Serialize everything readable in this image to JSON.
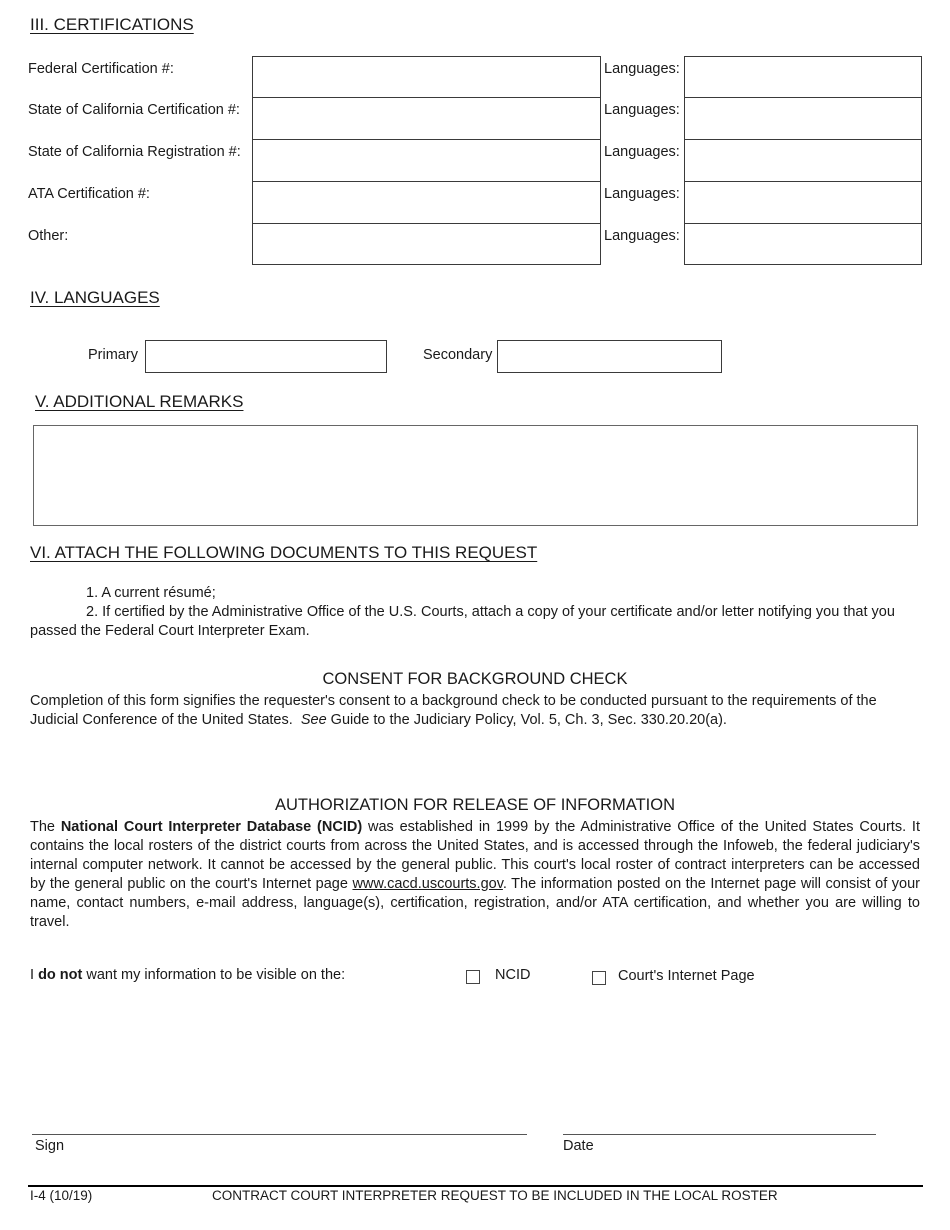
{
  "certifications": {
    "heading": "III.  CERTIFICATIONS",
    "rows": [
      {
        "label": "Federal Certification #:",
        "value": "",
        "languages_label": "Languages:",
        "languages_value": ""
      },
      {
        "label": "State of California Certification #:",
        "value": "",
        "languages_label": "Languages:",
        "languages_value": ""
      },
      {
        "label": "State of California Registration #:",
        "value": "",
        "languages_label": "Languages:",
        "languages_value": ""
      },
      {
        "label": "ATA Certification #:",
        "value": "",
        "languages_label": "Languages:",
        "languages_value": ""
      },
      {
        "label": "Other:",
        "value": "",
        "languages_label": "Languages:",
        "languages_value": ""
      }
    ]
  },
  "languages": {
    "heading": "IV.  LANGUAGES",
    "primary_label": "Primary",
    "primary_value": "",
    "secondary_label": "Secondary",
    "secondary_value": ""
  },
  "remarks": {
    "heading": "V.  ADDITIONAL REMARKS",
    "value": ""
  },
  "attachments": {
    "heading": "VI.  ATTACH THE FOLLOWING DOCUMENTS TO THIS REQUEST",
    "item1": "1.  A current résumé;",
    "item2_line1": "2.  If certified by the Administrative Office of the U.S. Courts, attach a copy of your certificate and/or letter notifying you that you",
    "item2_line2": "passed the Federal Court Interpreter Exam."
  },
  "consent": {
    "title": "CONSENT FOR BACKGROUND CHECK",
    "text_line1": "Completion of this form signifies the requester's consent to a background check to be conducted pursuant to the requirements of the",
    "text_line2_a": "Judicial Conference of the United States.  ",
    "text_line2_see": "See",
    "text_line2_b": " Guide to the Judiciary Policy, Vol. 5, Ch. 3, Sec. 330.20.20(a)."
  },
  "authorization": {
    "title": "AUTHORIZATION FOR RELEASE OF INFORMATION",
    "p_the": "The ",
    "p_bold": "National Court Interpreter Database (NCID)",
    "p_part1": " was established in 1999 by the Administrative Office of the United States Courts.  It contains the local rosters of the district courts from across the United States, and is accessed through the Infoweb, the federal judiciary's internal computer network.  It cannot be accessed by the general public.  This court's local roster of contract interpreters can be accessed by the general public on the court's Internet page ",
    "p_link": "www.cacd.uscourts.gov",
    "p_part2": ".  The information posted on the Internet page will consist of your name, contact numbers, e-mail address, language(s), certification, registration, and/or ATA certification, and whether you are willing to travel."
  },
  "visibility": {
    "prefix": "I ",
    "bold": "do not",
    "suffix": " want my information to be visible on the:",
    "options": [
      {
        "label": "NCID",
        "checked": false
      },
      {
        "label": "Court's Internet Page",
        "checked": false
      }
    ]
  },
  "signature": {
    "sign_label": "Sign",
    "date_label": "Date"
  },
  "footer": {
    "form_id": "I-4 (10/19)",
    "form_title": "CONTRACT COURT INTERPRETER REQUEST TO BE INCLUDED IN THE LOCAL ROSTER"
  }
}
